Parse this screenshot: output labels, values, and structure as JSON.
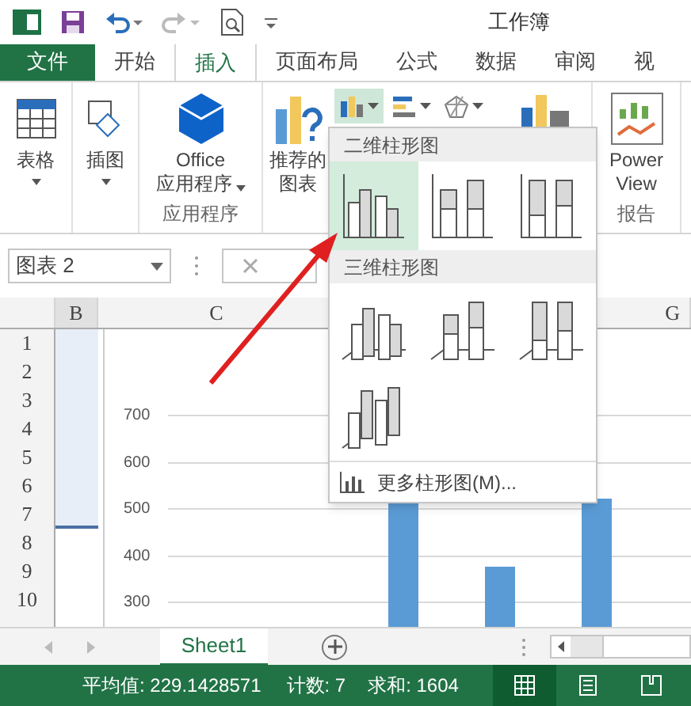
{
  "title_bar": {
    "title": "工作簿"
  },
  "ribbon_tabs": [
    {
      "label": "文件",
      "kind": "file",
      "selected": false
    },
    {
      "label": "开始",
      "kind": "tab",
      "selected": false
    },
    {
      "label": "插入",
      "kind": "tab",
      "selected": true
    },
    {
      "label": "页面布局",
      "kind": "tab",
      "selected": false
    },
    {
      "label": "公式",
      "kind": "tab",
      "selected": false
    },
    {
      "label": "数据",
      "kind": "tab",
      "selected": false
    },
    {
      "label": "审阅",
      "kind": "tab",
      "selected": false
    },
    {
      "label": "视",
      "kind": "tab",
      "selected": false
    }
  ],
  "ribbon_groups": [
    {
      "buttons": [
        {
          "kind": "table",
          "lines": [
            "表格"
          ],
          "caret": true
        }
      ]
    },
    {
      "buttons": [
        {
          "kind": "illustration",
          "lines": [
            "插图"
          ],
          "caret": true
        }
      ]
    },
    {
      "label": "应用程序",
      "buttons": [
        {
          "kind": "office",
          "lines": [
            "Office",
            "应用程序"
          ],
          "caret": true
        }
      ]
    },
    {
      "buttons": [
        {
          "kind": "recommended",
          "lines": [
            "推荐的",
            "图表"
          ]
        },
        {
          "kind": "chart-types"
        }
      ]
    },
    {
      "label": "报告",
      "buttons": [
        {
          "kind": "powerview",
          "lines": [
            "Power",
            "View"
          ]
        }
      ]
    }
  ],
  "chart_type_buttons": [
    {
      "kind": "column",
      "selected": true
    },
    {
      "kind": "bar",
      "selected": false
    },
    {
      "kind": "radar",
      "selected": false
    }
  ],
  "formula_bar": {
    "name_box": "图表 2"
  },
  "columns": [
    "B",
    "C",
    "G"
  ],
  "rows": [
    "1",
    "2",
    "3",
    "4",
    "5",
    "6",
    "7",
    "8",
    "9",
    "10"
  ],
  "chart": {
    "y_labels": [
      "700",
      "600",
      "500",
      "400",
      "300"
    ]
  },
  "gallery": {
    "sections": [
      {
        "title": "二维柱形图",
        "items": [
          {
            "kind": "clustered",
            "selected": true
          },
          {
            "kind": "stacked",
            "selected": false
          },
          {
            "kind": "stacked100",
            "selected": false
          }
        ]
      },
      {
        "title": "三维柱形图",
        "items": [
          {
            "kind": "clustered3d",
            "selected": false
          },
          {
            "kind": "stacked3d",
            "selected": false
          },
          {
            "kind": "stacked100-3d",
            "selected": false
          },
          {
            "kind": "column3d",
            "selected": false
          }
        ]
      }
    ],
    "more": "更多柱形图(M)..."
  },
  "sheet_tabs": [
    {
      "label": "Sheet1",
      "selected": true
    }
  ],
  "status_bar": {
    "items": [
      "平均值: 229.1428571",
      "计数: 7",
      "求和: 1604"
    ],
    "views": [
      {
        "kind": "normal",
        "selected": true
      },
      {
        "kind": "page-layout",
        "selected": false
      },
      {
        "kind": "page-break",
        "selected": false
      }
    ]
  }
}
